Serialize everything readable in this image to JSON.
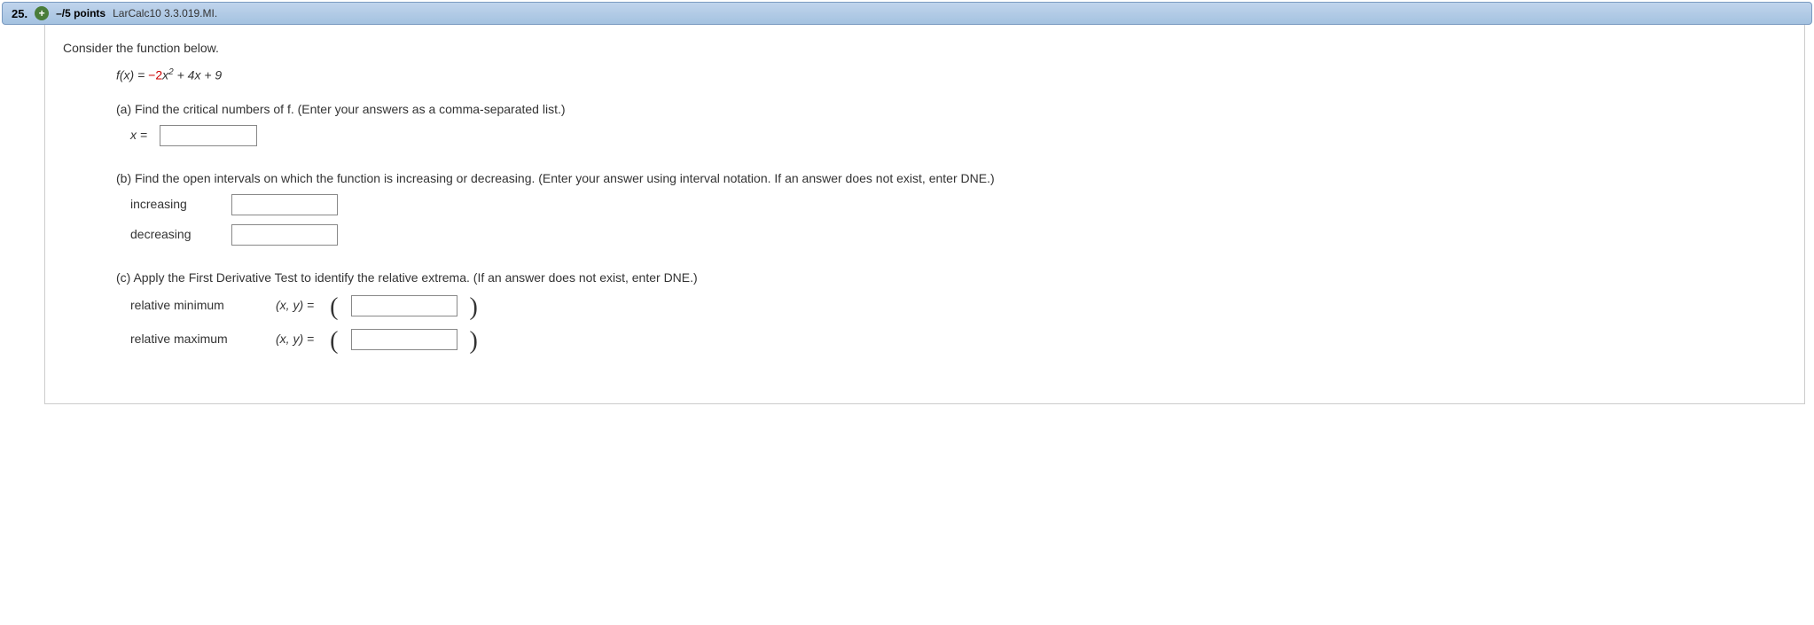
{
  "header": {
    "number": "25.",
    "expand_symbol": "+",
    "points": "–/5 points",
    "source": "LarCalc10 3.3.019.MI."
  },
  "intro": "Consider the function below.",
  "func": {
    "prefix": "f(x) = ",
    "coef": "−2",
    "var1": "x",
    "exp": "2",
    "rest": " + 4x + 9"
  },
  "parts": {
    "a": {
      "text": "(a) Find the critical numbers of f. (Enter your answers as a comma-separated list.)",
      "label": "x ="
    },
    "b": {
      "text": "(b) Find the open intervals on which the function is increasing or decreasing. (Enter your answer using interval notation. If an answer does not exist, enter DNE.)",
      "inc": "increasing",
      "dec": "decreasing"
    },
    "c": {
      "text": "(c) Apply the First Derivative Test to identify the relative extrema. (If an answer does not exist, enter DNE.)",
      "min": "relative minimum",
      "max": "relative maximum",
      "xy": "(x, y) ="
    }
  }
}
